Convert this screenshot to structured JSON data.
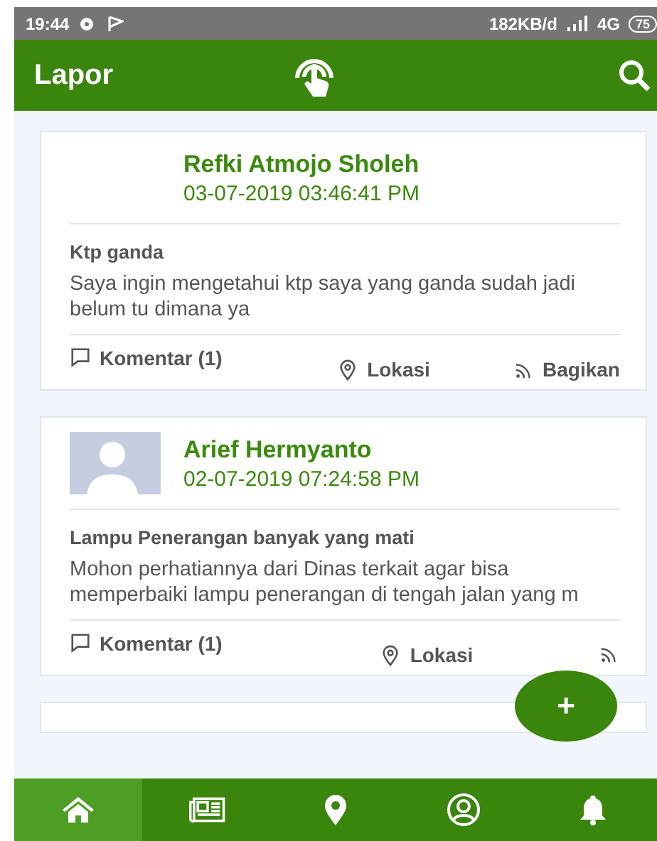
{
  "status_bar": {
    "time": "19:44",
    "speed": "182KB/d",
    "network": "4G",
    "battery": "75"
  },
  "app_bar": {
    "title": "Lapor"
  },
  "posts": [
    {
      "has_avatar": false,
      "name": "Refki Atmojo Sholeh",
      "date": "03-07-2019 03:46:41 PM",
      "title": "Ktp ganda",
      "body": "Saya ingin mengetahui ktp saya yang ganda sudah jadi belum tu dimana ya",
      "actions": [
        {
          "kind": "comment",
          "label": "Komentar (1)"
        },
        {
          "kind": "location",
          "label": "Lokasi"
        },
        {
          "kind": "share",
          "label": "Bagikan"
        }
      ]
    },
    {
      "has_avatar": true,
      "name": "Arief Hermyanto",
      "date": "02-07-2019 07:24:58 PM",
      "title": "Lampu Penerangan banyak yang mati",
      "body": "Mohon perhatiannya dari Dinas terkait agar bisa memperbaiki lampu penerangan di tengah jalan yang m",
      "actions": [
        {
          "kind": "comment",
          "label": "Komentar (1)"
        },
        {
          "kind": "location",
          "label": "Lokasi"
        },
        {
          "kind": "share"
        }
      ]
    }
  ],
  "fab": {
    "label": "+"
  },
  "bottom_nav": [
    {
      "kind": "home",
      "selected": true
    },
    {
      "kind": "news",
      "selected": false
    },
    {
      "kind": "map",
      "selected": false
    },
    {
      "kind": "profile",
      "selected": false
    },
    {
      "kind": "notifications",
      "selected": false
    }
  ]
}
